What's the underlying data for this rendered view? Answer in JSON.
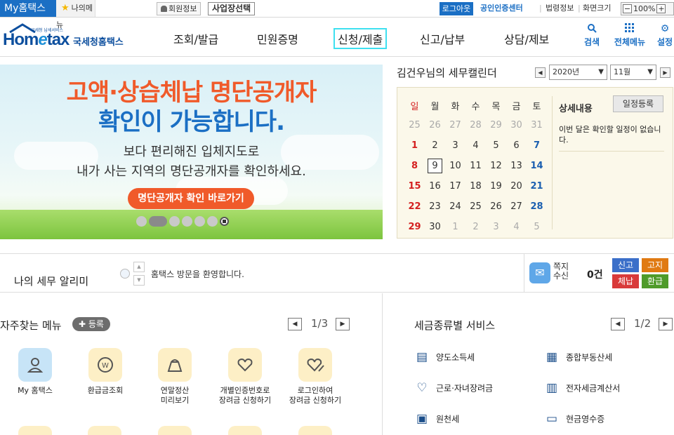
{
  "topbar": {
    "my_hometax": "My홈택스",
    "my_menu": "나의메뉴",
    "member_info": "회원정보",
    "business_select": "사업장선택",
    "logout": "로그아웃",
    "cert_center": "공인인증센터",
    "law_info": "법령정보",
    "screen_size": "화면크기",
    "zoom_level": "100%"
  },
  "header": {
    "logo_small": "국세청 납세서비스",
    "logo_text": "Hometax",
    "logo_sub": "국세청홈택스",
    "nav": [
      "조회/발급",
      "민원증명",
      "신청/제출",
      "신고/납부",
      "상담/제보"
    ],
    "icons": [
      "검색",
      "전체메뉴",
      "설정"
    ]
  },
  "banner": {
    "line1": "고액·상습체납 명단공개자",
    "line2": "확인이 가능합니다.",
    "line3": "보다 편리해진 입체지도로",
    "line4": "내가 사는 지역의 명단공개자를 확인하세요.",
    "button": "명단공개자 확인 바로가기"
  },
  "calendar": {
    "title": "김건우님의 세무캘린더",
    "year": "2020년",
    "month": "11월",
    "weekdays": [
      "일",
      "월",
      "화",
      "수",
      "목",
      "금",
      "토"
    ],
    "weeks": [
      [
        "25",
        "26",
        "27",
        "28",
        "29",
        "30",
        "31"
      ],
      [
        "1",
        "2",
        "3",
        "4",
        "5",
        "6",
        "7"
      ],
      [
        "8",
        "9",
        "10",
        "11",
        "12",
        "13",
        "14"
      ],
      [
        "15",
        "16",
        "17",
        "18",
        "19",
        "20",
        "21"
      ],
      [
        "22",
        "23",
        "24",
        "25",
        "26",
        "27",
        "28"
      ],
      [
        "29",
        "30",
        "1",
        "2",
        "3",
        "4",
        "5"
      ]
    ],
    "today": "9",
    "detail_title": "상세내용",
    "add_button": "일정등록",
    "detail_text": "이번 달은 확인할 일정이 없습니다."
  },
  "notice": {
    "title": "나의 세무 알리미",
    "message": "홈택스 방문을 환영합니다.",
    "mail_label": "쪽지수신",
    "mail_count": "0건",
    "tags": [
      "신고",
      "고지",
      "체납",
      "환급"
    ]
  },
  "favorites": {
    "title": "자주찾는 메뉴",
    "register": "등록",
    "page": "1/3",
    "items": [
      "My 홈택스",
      "환급금조회",
      "연말정산\n미리보기",
      "개별인증번호로\n장려금 신청하기",
      "로그인하여\n장려금 신청하기"
    ]
  },
  "tax_services": {
    "title": "세금종류별 서비스",
    "page": "1/2",
    "items": [
      "양도소득세",
      "종합부동산세",
      "근로·자녀장려금",
      "전자세금계산서",
      "원천세",
      "현금영수증"
    ]
  },
  "colors": {
    "brand_blue": "#1b6fc4",
    "banner_orange": "#f05a2a",
    "sunday_red": "#d42020",
    "saturday_blue": "#1b5fb0",
    "tag_report": "#3b6fc9",
    "tag_notice": "#e07a12",
    "tag_arrears": "#d93a3a",
    "tag_refund": "#4f9b2a"
  }
}
